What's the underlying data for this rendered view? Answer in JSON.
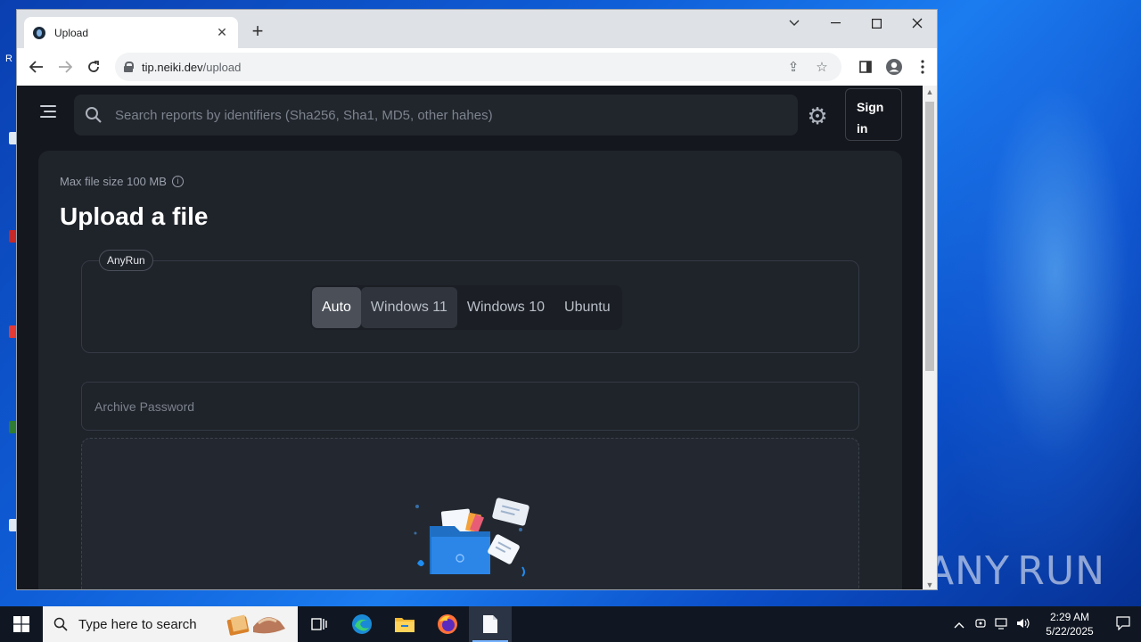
{
  "browser": {
    "tab_title": "Upload",
    "url_host": "tip.neiki.dev",
    "url_path": "/upload"
  },
  "page": {
    "search_placeholder": "Search reports by identifiers (Sha256, Sha1, MD5, other hahes)",
    "signin_label": "Sign in",
    "max_file_size": "Max file size 100 MB",
    "heading": "Upload a file",
    "sandbox_badge": "AnyRun",
    "os_options": [
      "Auto",
      "Windows 11",
      "Windows 10",
      "Ubuntu"
    ],
    "os_selected": "Auto",
    "archive_password_placeholder": "Archive Password"
  },
  "taskbar": {
    "search_placeholder": "Type here to search",
    "time": "2:29 AM",
    "date": "5/22/2025"
  },
  "desktop": {
    "watermark": "ANY RUN"
  },
  "colors": {
    "page_bg": "#14171d",
    "card_bg": "#1f232a",
    "segment_active": "#4a4f58",
    "desktop_blue": "#0f5ed8"
  }
}
